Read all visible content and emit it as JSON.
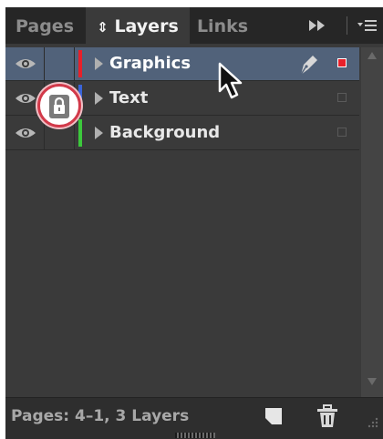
{
  "tabs": [
    {
      "label": "Pages",
      "active": false
    },
    {
      "label": "Layers",
      "active": true,
      "prefix_icon": "up-down-arrows-icon"
    },
    {
      "label": "Links",
      "active": false
    }
  ],
  "tab_bar": {
    "expand_icon": "double-arrow-right-icon",
    "menu_icon": "panel-menu-icon"
  },
  "layers": [
    {
      "name": "Graphics",
      "color": "#e8202a",
      "visible": true,
      "locked": false,
      "selected": true
    },
    {
      "name": "Text",
      "color": "#3a64d8",
      "visible": true,
      "locked": true,
      "selected": false
    },
    {
      "name": "Background",
      "color": "#3cc83c",
      "visible": true,
      "locked": false,
      "selected": false
    }
  ],
  "colors": {
    "panel_bg": "#3a3a3a",
    "selected_row_bg": "#51627a",
    "highlight_ring": "#d23a4a"
  },
  "footer": {
    "status": "Pages: 4–1, 3 Layers"
  }
}
